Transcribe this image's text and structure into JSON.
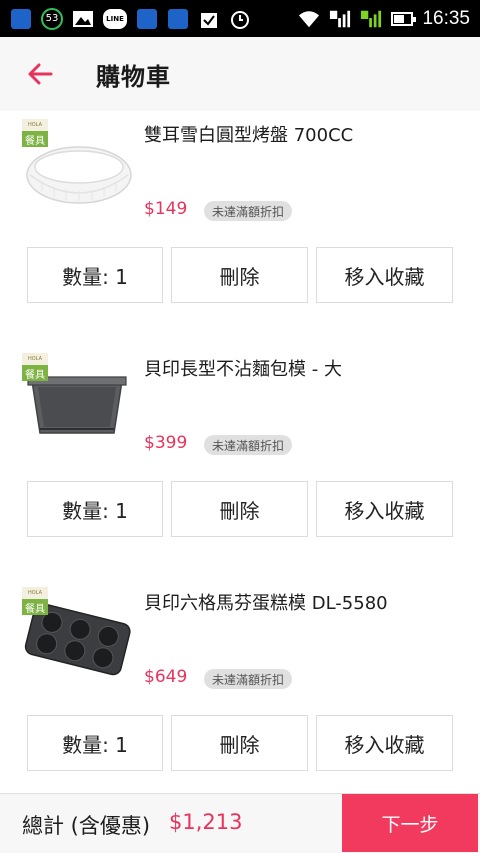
{
  "statusbar": {
    "notification_count": "53",
    "line_label": "LINE",
    "sim1": "1",
    "sim2": "2",
    "time": "16:35"
  },
  "header": {
    "title": "購物車",
    "back_icon": "arrow-left-icon",
    "accent": "#e8335c"
  },
  "cart": {
    "items": [
      {
        "name": "雙耳雪白圓型烤盤 700CC",
        "price": "$149",
        "badge": "未達滿額折扣",
        "tag_top": "HOLA",
        "tag_bottom": "餐具",
        "quantity_label": "數量: 1",
        "delete_label": "刪除",
        "favorite_label": "移入收藏",
        "image_icon": "white-round-baking-dish"
      },
      {
        "name": "貝印長型不沾麵包模 - 大",
        "price": "$399",
        "badge": "未達滿額折扣",
        "tag_top": "HOLA",
        "tag_bottom": "餐具",
        "quantity_label": "數量: 1",
        "delete_label": "刪除",
        "favorite_label": "移入收藏",
        "image_icon": "loaf-pan"
      },
      {
        "name": "貝印六格馬芬蛋糕模 DL-5580",
        "price": "$649",
        "badge": "未達滿額折扣",
        "tag_top": "HOLA",
        "tag_bottom": "餐具",
        "quantity_label": "數量: 1",
        "delete_label": "刪除",
        "favorite_label": "移入收藏",
        "image_icon": "muffin-pan"
      }
    ]
  },
  "footer": {
    "total_label": "總計 (含優惠)",
    "total_value": "$1,213",
    "next_label": "下一步",
    "next_color": "#f23a5e"
  }
}
